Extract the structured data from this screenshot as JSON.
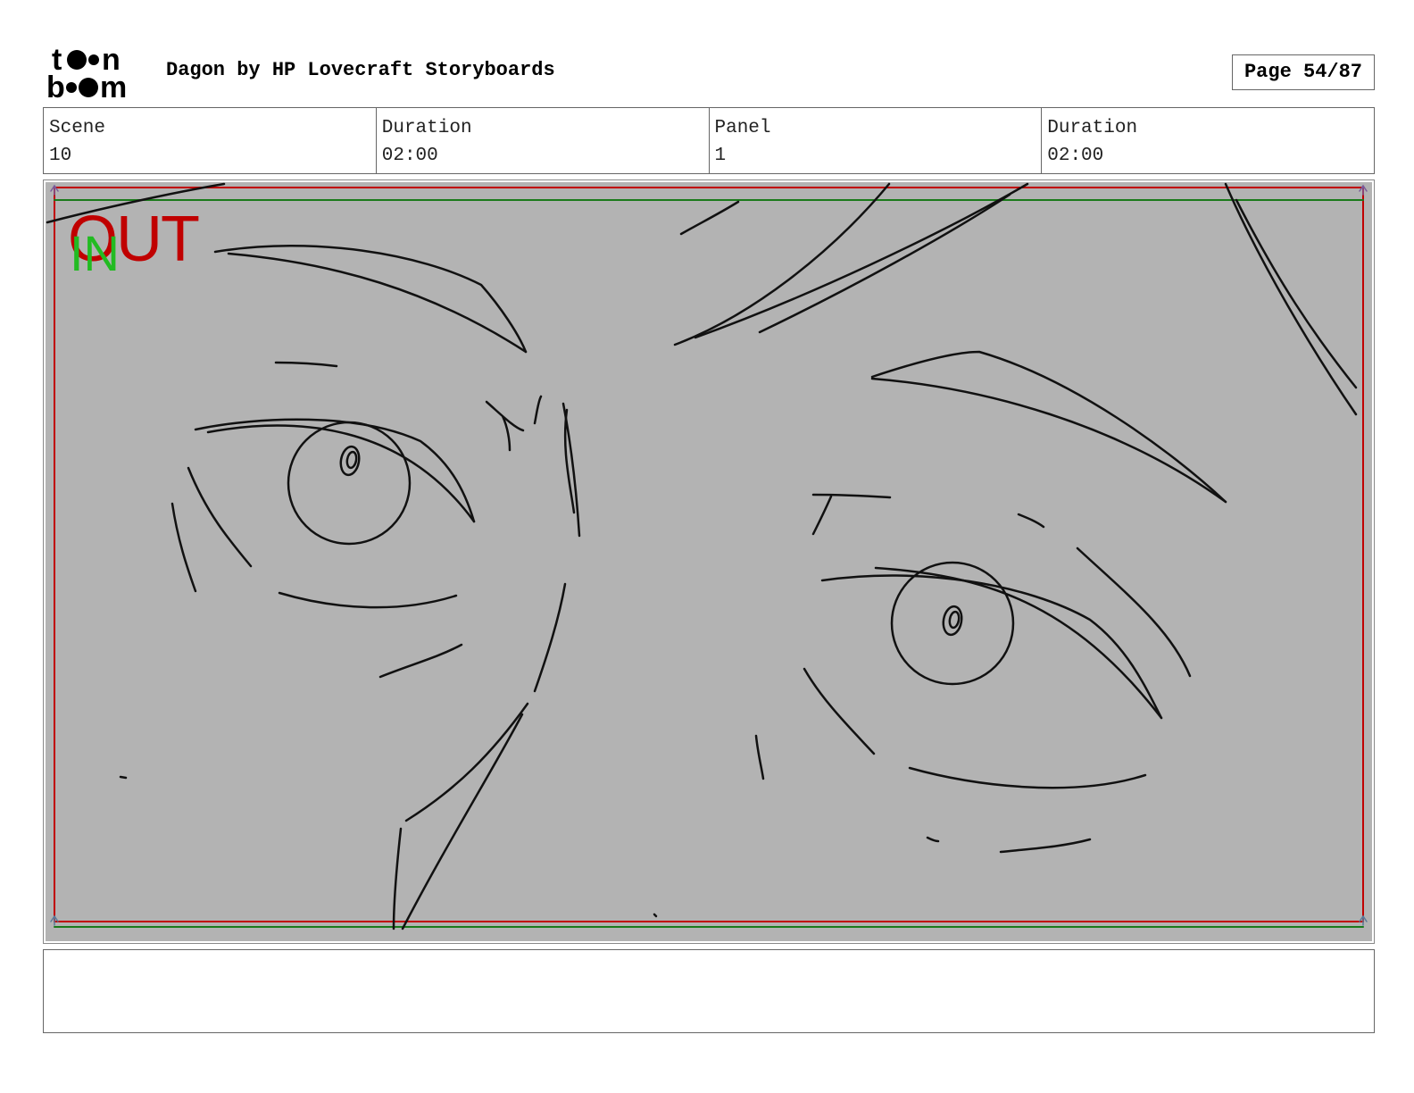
{
  "header": {
    "logo_text_top": "toon",
    "logo_text_bottom": "boom",
    "title": "Dagon by HP Lovecraft Storyboards",
    "page_label": "Page 54/87"
  },
  "info": [
    {
      "label": "Scene",
      "value": "10"
    },
    {
      "label": "Duration",
      "value": "02:00"
    },
    {
      "label": "Panel",
      "value": "1"
    },
    {
      "label": "Duration",
      "value": "02:00"
    }
  ],
  "panel": {
    "out_label": "OUT",
    "in_label": "IN",
    "safe_frame_color": "#c00000",
    "title_safe_color": "#1a7a1a",
    "background_color": "#b3b3b3",
    "drawing": "pencil sketch close-up of a pair of eyes"
  },
  "notes": {
    "text": ""
  }
}
